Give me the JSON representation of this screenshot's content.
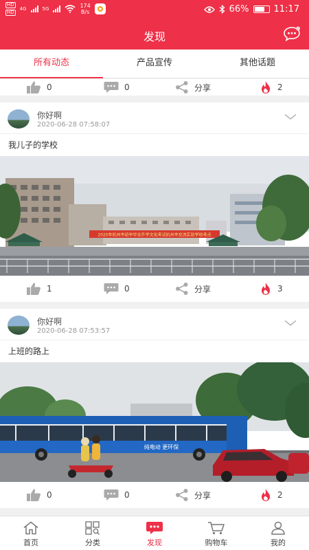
{
  "status_bar": {
    "hd1": "HD",
    "hd2": "HD",
    "net1": "4G",
    "net2": "5G",
    "speed_value": "174",
    "speed_unit": "B/s",
    "battery": "66%",
    "time": "11:17"
  },
  "header": {
    "title": "发现",
    "message_icon": "chat-bubble-icon"
  },
  "tabs": [
    {
      "label": "所有动态",
      "active": true
    },
    {
      "label": "产品宣传",
      "active": false
    },
    {
      "label": "其他话题",
      "active": false
    }
  ],
  "top_actions": {
    "likes": "0",
    "comments": "0",
    "share": "分享",
    "hot": "2"
  },
  "posts": [
    {
      "user": "你好啊",
      "time": "2020-06-28 07:58:07",
      "text": "我儿子的学校",
      "banner": "2020年杭州市初中毕业升学文化考试杭州市交流实验学校考点",
      "likes": "1",
      "comments": "0",
      "share": "分享",
      "hot": "3"
    },
    {
      "user": "你好啊",
      "time": "2020-06-28 07:53:57",
      "text": "上班的路上",
      "bus_text": "纯电动 更环保",
      "likes": "0",
      "comments": "0",
      "share": "分享",
      "hot": "2"
    }
  ],
  "bottom_nav": [
    {
      "label": "首页",
      "active": false
    },
    {
      "label": "分类",
      "active": false
    },
    {
      "label": "发现",
      "active": true
    },
    {
      "label": "购物车",
      "active": false
    },
    {
      "label": "我的",
      "active": false
    }
  ],
  "colors": {
    "brand": "#ee3048",
    "hot": "#ee3048",
    "icon_grey": "#999999"
  }
}
